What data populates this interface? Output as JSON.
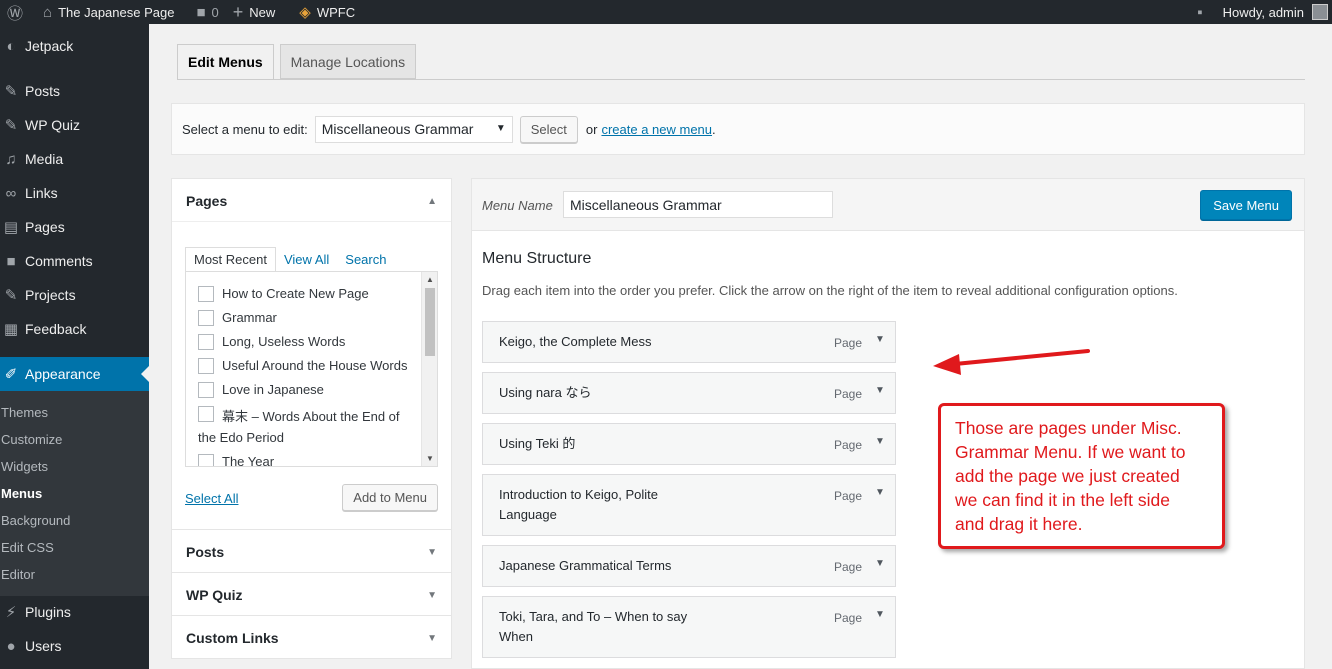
{
  "adminbar": {
    "site": "The Japanese Page",
    "comments": "0",
    "new": "New",
    "wpfc": "WPFC",
    "greeting": "Howdy, admin"
  },
  "sidebar": {
    "items": [
      {
        "label": "Jetpack",
        "icon": "jetpack-icon"
      },
      {
        "label": "Posts",
        "icon": "pin-icon"
      },
      {
        "label": "WP Quiz",
        "icon": "quiz-icon"
      },
      {
        "label": "Media",
        "icon": "media-icon"
      },
      {
        "label": "Links",
        "icon": "link-icon"
      },
      {
        "label": "Pages",
        "icon": "pages-icon"
      },
      {
        "label": "Comments",
        "icon": "comment-icon"
      },
      {
        "label": "Projects",
        "icon": "pin-icon"
      },
      {
        "label": "Feedback",
        "icon": "feedback-icon"
      },
      {
        "label": "Appearance",
        "icon": "brush-icon"
      },
      {
        "label": "Plugins",
        "icon": "plugin-icon"
      },
      {
        "label": "Users",
        "icon": "user-icon"
      }
    ],
    "submenu": [
      "Themes",
      "Customize",
      "Widgets",
      "Menus",
      "Background",
      "Edit CSS",
      "Editor"
    ]
  },
  "tabs": {
    "edit": "Edit Menus",
    "manage": "Manage Locations"
  },
  "selectbar": {
    "label": "Select a menu to edit:",
    "selected": "Miscellaneous Grammar",
    "select_btn": "Select",
    "or": "or",
    "create_link": "create a new menu",
    "period": "."
  },
  "pages_box": {
    "title": "Pages",
    "tabs": [
      "Most Recent",
      "View All",
      "Search"
    ],
    "items": [
      "How to Create New Page",
      "Grammar",
      "Long, Useless Words",
      "Useful Around the House Words",
      "Love in Japanese",
      "幕末 – Words About the End of",
      "the Edo Period",
      "The Year"
    ],
    "select_all": "Select All",
    "add_to_menu": "Add to Menu"
  },
  "other_boxes": [
    "Posts",
    "WP Quiz",
    "Custom Links"
  ],
  "menu_panel": {
    "name_label": "Menu Name",
    "name_value": "Miscellaneous Grammar",
    "save": "Save Menu",
    "structure_title": "Menu Structure",
    "structure_desc": "Drag each item into the order you prefer. Click the arrow on the right of the item to reveal additional configuration options.",
    "items": [
      {
        "title": "Keigo, the Complete Mess",
        "type": "Page"
      },
      {
        "title": "Using nara なら",
        "type": "Page"
      },
      {
        "title": "Using Teki 的",
        "type": "Page"
      },
      {
        "title": "Introduction to Keigo, Polite",
        "title2": "Language",
        "type": "Page"
      },
      {
        "title": "Japanese Grammatical Terms",
        "type": "Page"
      },
      {
        "title": "Toki, Tara, and To – When to say",
        "title2": "When",
        "type": "Page"
      }
    ]
  },
  "annotation": {
    "lines": [
      "Those are pages under Misc.",
      "Grammar Menu. If we want to",
      "add the page we just created",
      "we can find it in the left side",
      "and drag it here."
    ],
    "color": "#e0191c"
  }
}
